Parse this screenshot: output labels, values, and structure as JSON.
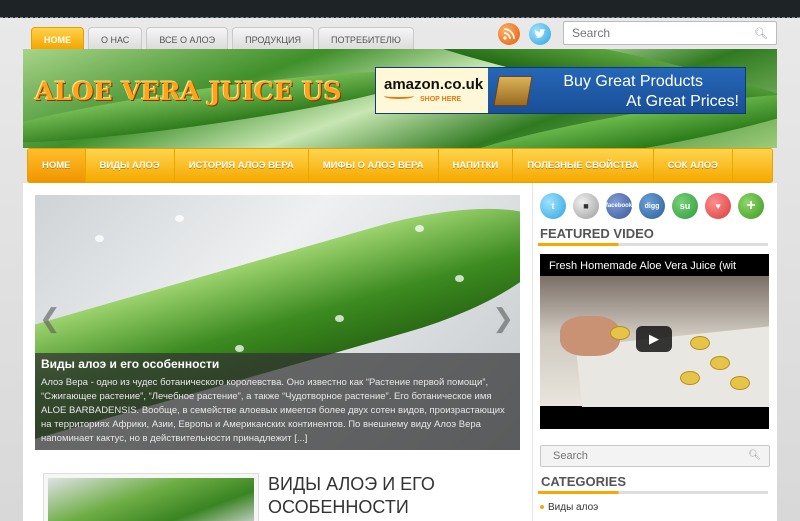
{
  "topnav": {
    "tabs": [
      {
        "label": "HOME",
        "active": true
      },
      {
        "label": "О НАС",
        "active": false
      },
      {
        "label": "ВСЕ О АЛОЭ",
        "active": false
      },
      {
        "label": "ПРОДУКЦИЯ",
        "active": false
      },
      {
        "label": "ПОТРЕБИТЕЛЮ",
        "active": false
      }
    ],
    "rss_icon": "rss-icon",
    "twitter_icon": "twitter-icon",
    "search_placeholder": "Search"
  },
  "header": {
    "logo": "ALOE VERA JUICE US",
    "ad": {
      "brand": "amazon.co.uk",
      "shop_here": "SHOP HERE",
      "line1": "Buy Great Products",
      "line2": "At Great Prices!"
    }
  },
  "mainnav": {
    "items": [
      {
        "label": "HOME",
        "active": true
      },
      {
        "label": "ВИДЫ АЛОЭ",
        "active": false
      },
      {
        "label": "ИСТОРИЯ АЛОЭ ВЕРА",
        "active": false
      },
      {
        "label": "МИФЫ О АЛОЭ ВЕРА",
        "active": false
      },
      {
        "label": "НАПИТКИ",
        "active": false
      },
      {
        "label": "ПОЛЕЗНЫЕ СВОЙСТВА",
        "active": false
      },
      {
        "label": "СОК АЛОЭ",
        "active": false
      }
    ]
  },
  "slider": {
    "caption_title": "Виды алоэ и его особенности",
    "caption_body": "Алоэ Вера - одно из чудес ботанического королевства. Оно известно как “Растение первой помощи”, “Сжигающее растение”, “Лечебное растение”, а также “Чудотворное растение”. Его ботаническое имя ALOE BARBADENSIS. Вообще, в семействе алоевых имеется более двух сотен видов, произрастающих на территориях Африки, Азии, Европы и Американских континентов. По внешнему виду Алоэ Вера напоминает кактус, но в действительности принадлежит [...]",
    "prev_icon": "chevron-left-icon",
    "next_icon": "chevron-right-icon"
  },
  "post": {
    "title_line1": "ВИДЫ АЛОЭ И ЕГО",
    "title_line2": "ОСОБЕННОСТИ"
  },
  "sidebar": {
    "share_icons": {
      "twitter": "t",
      "delicious": "■",
      "facebook": "facebook",
      "digg": "digg",
      "stumbleupon": "su",
      "favorite": "♥",
      "add": "+"
    },
    "featured_video_title": "FEATURED VIDEO",
    "video_title": "Fresh Homemade Aloe Vera Juice (wit",
    "search_placeholder": "Search",
    "categories_title": "CATEGORIES",
    "categories": [
      {
        "label": "Виды алоэ"
      }
    ]
  },
  "colors": {
    "accent": "#f5a800",
    "topbar": "#1e2426",
    "ad_blue": "#2567b8"
  }
}
